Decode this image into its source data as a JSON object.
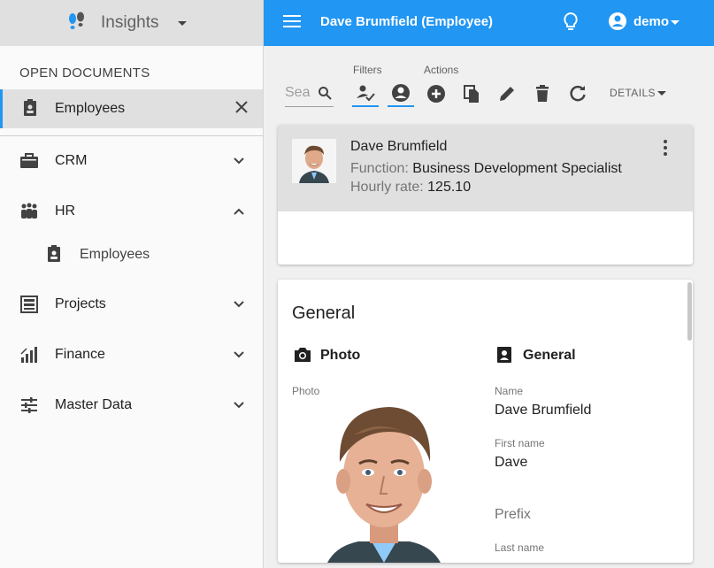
{
  "sidebar": {
    "app_title": "Insights",
    "open_documents_label": "OPEN DOCUMENTS",
    "open_doc": {
      "label": "Employees"
    },
    "items": [
      {
        "label": "CRM",
        "icon": "briefcase-icon",
        "expanded": false
      },
      {
        "label": "HR",
        "icon": "people-icon",
        "expanded": true
      },
      {
        "label": "Employees",
        "icon": "badge-icon",
        "sub": true
      },
      {
        "label": "Projects",
        "icon": "cabinet-icon",
        "expanded": false
      },
      {
        "label": "Finance",
        "icon": "bar-chart-icon",
        "expanded": false
      },
      {
        "label": "Master Data",
        "icon": "sliders-icon",
        "expanded": false
      }
    ]
  },
  "topbar": {
    "title": "Dave Brumfield (Employee)",
    "user": "demo"
  },
  "toolbar": {
    "search_placeholder": "Sea",
    "filters_label": "Filters",
    "actions_label": "Actions",
    "details_label": "DETAILS"
  },
  "record": {
    "name": "Dave Brumfield",
    "function_label": "Function:",
    "function_value": "Business Development Specialist",
    "rate_label": "Hourly rate:",
    "rate_value": "125.10"
  },
  "detail": {
    "section_title": "General",
    "photo_heading": "Photo",
    "general_heading": "General",
    "photo_label": "Photo",
    "name_label": "Name",
    "name_value": "Dave Brumfield",
    "first_name_label": "First name",
    "first_name_value": "Dave",
    "prefix_label": "Prefix",
    "last_name_label": "Last name"
  },
  "colors": {
    "accent": "#2196f3",
    "sidebar_bg": "#fafafa",
    "selected_bg": "#e0e0e0"
  }
}
